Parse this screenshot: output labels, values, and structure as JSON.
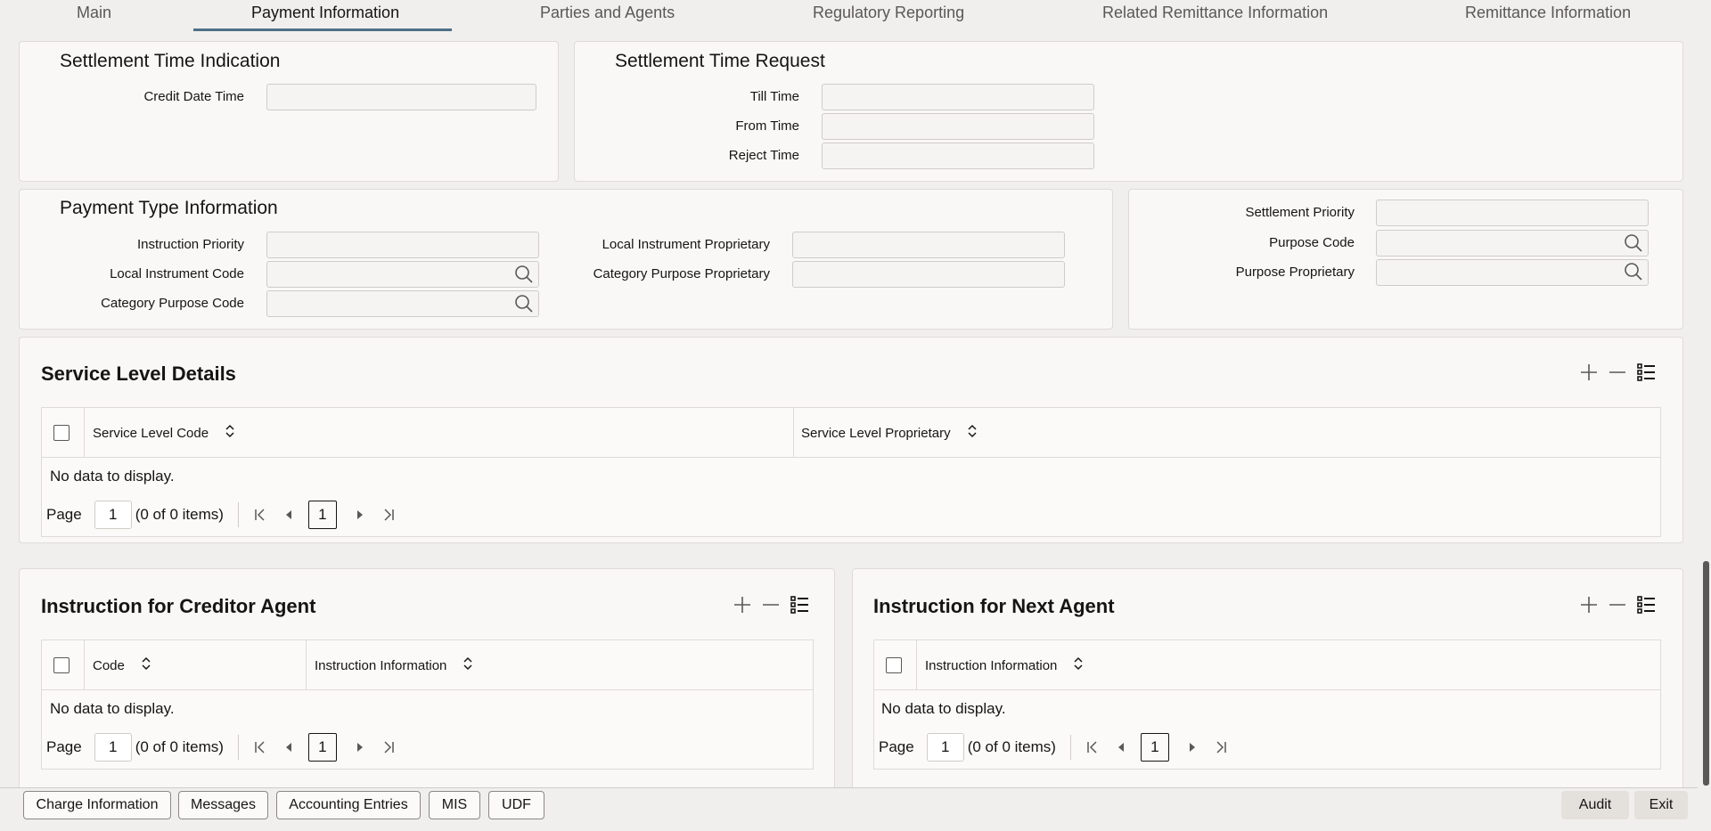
{
  "tabs": [
    {
      "label": "Main"
    },
    {
      "label": "Payment Information"
    },
    {
      "label": "Parties and Agents"
    },
    {
      "label": "Regulatory Reporting"
    },
    {
      "label": "Related Remittance Information"
    },
    {
      "label": "Remittance Information"
    }
  ],
  "settlement_indication": {
    "title": "Settlement Time Indication",
    "credit_date_time_label": "Credit Date Time",
    "credit_date_time_value": ""
  },
  "settlement_request": {
    "title": "Settlement Time Request",
    "till_time_label": "Till Time",
    "from_time_label": "From Time",
    "reject_time_label": "Reject Time"
  },
  "payment_type": {
    "title": "Payment Type Information",
    "instruction_priority_label": "Instruction Priority",
    "local_instrument_code_label": "Local Instrument Code",
    "category_purpose_code_label": "Category Purpose Code",
    "local_instrument_proprietary_label": "Local Instrument Proprietary",
    "category_purpose_proprietary_label": "Category Purpose Proprietary"
  },
  "purpose": {
    "settlement_priority_label": "Settlement Priority",
    "purpose_code_label": "Purpose Code",
    "purpose_proprietary_label": "Purpose Proprietary"
  },
  "service_level": {
    "title": "Service Level Details",
    "columns": [
      "Service Level Code",
      "Service Level Proprietary"
    ],
    "no_data": "No data to display.",
    "page_label": "Page",
    "page_value": "1",
    "items_text": "(0 of 0 items)",
    "current_page": "1"
  },
  "creditor_agent": {
    "title": "Instruction for Creditor Agent",
    "columns": [
      "Code",
      "Instruction Information"
    ],
    "no_data": "No data to display.",
    "page_label": "Page",
    "page_value": "1",
    "items_text": "(0 of 0 items)",
    "current_page": "1"
  },
  "next_agent": {
    "title": "Instruction for Next Agent",
    "columns": [
      "Instruction Information"
    ],
    "no_data": "No data to display.",
    "page_label": "Page",
    "page_value": "1",
    "items_text": "(0 of 0 items)",
    "current_page": "1"
  },
  "footer": {
    "charge_information": "Charge Information",
    "messages": "Messages",
    "accounting_entries": "Accounting Entries",
    "mis": "MIS",
    "udf": "UDF",
    "audit": "Audit",
    "exit": "Exit"
  },
  "colors": {
    "background": "#f1efed",
    "panel": "#f9f8f7",
    "active_tab_underline": "#4f6f87"
  }
}
